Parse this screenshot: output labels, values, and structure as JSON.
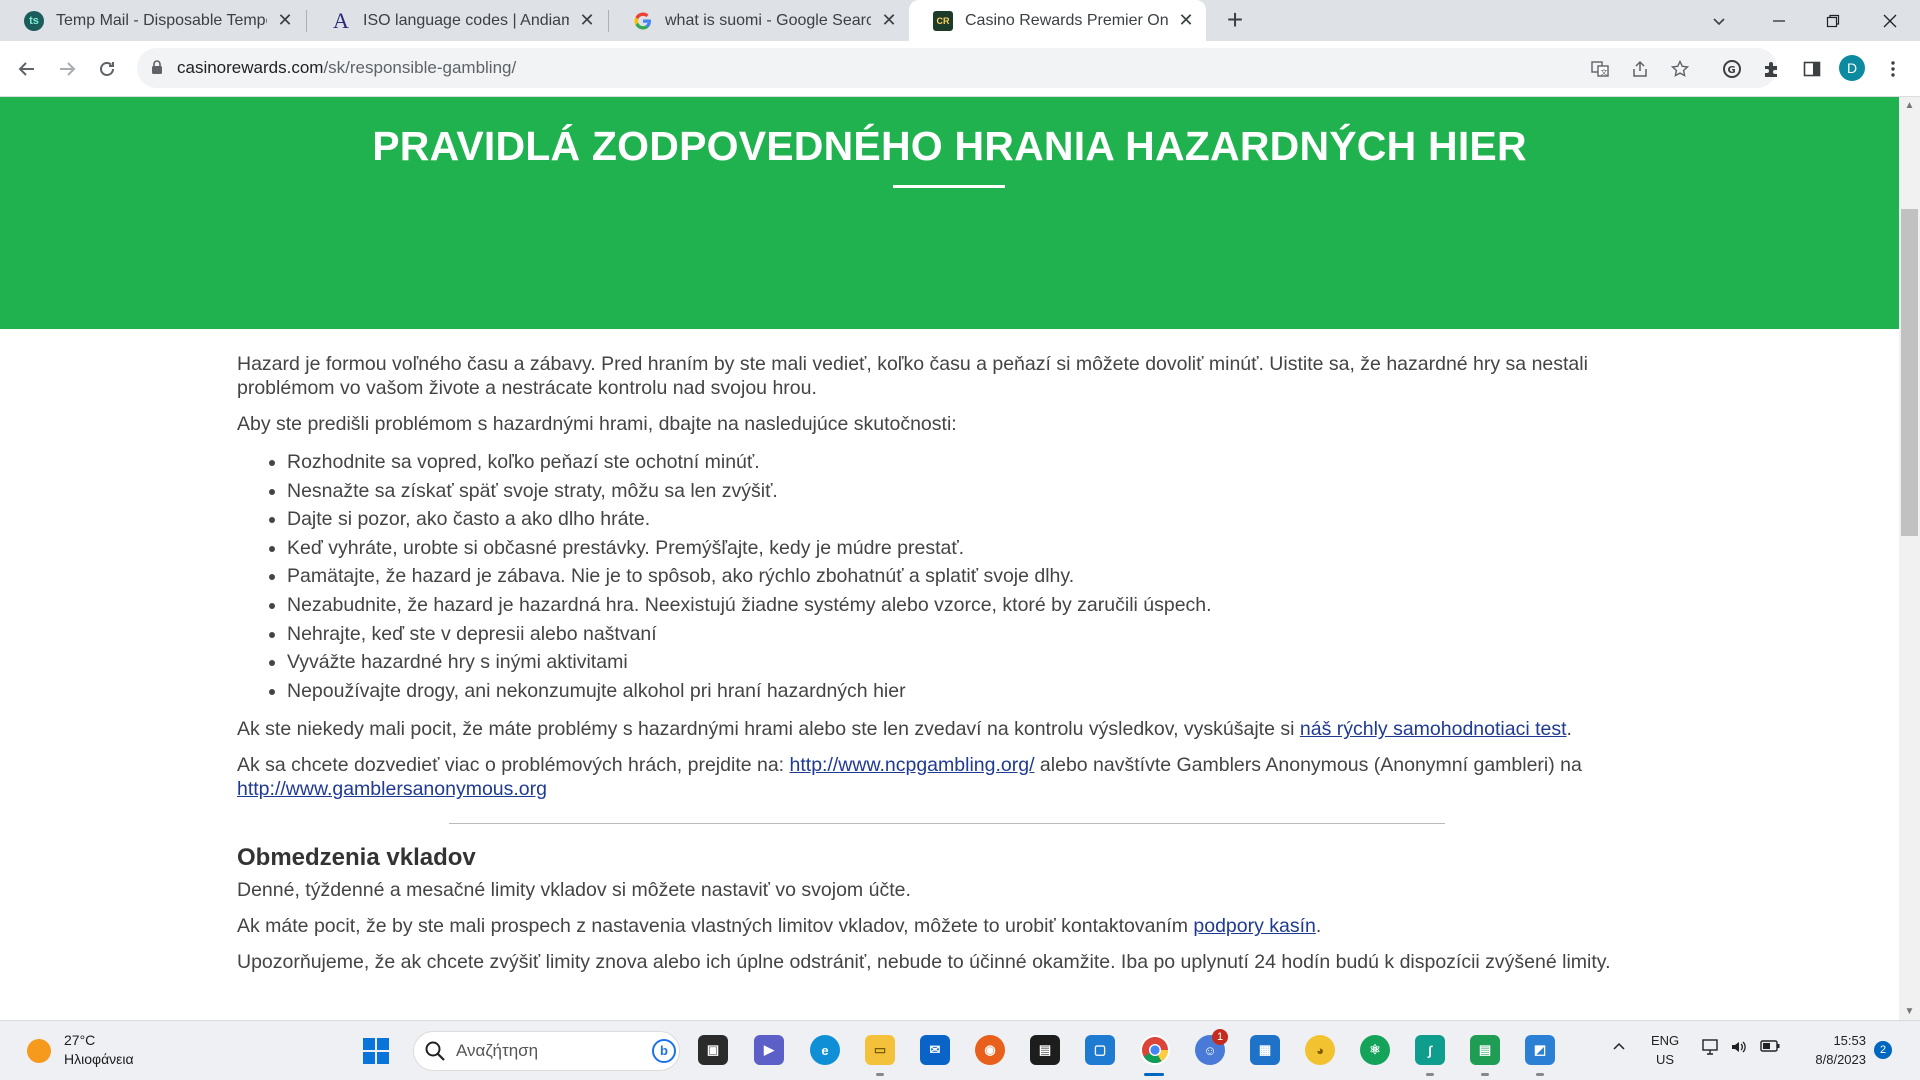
{
  "browser": {
    "tabs": [
      {
        "title": "Temp Mail - Disposable Temporary Email",
        "favicon": "tempmail-icon",
        "active": false
      },
      {
        "title": "ISO language codes | Andiamo! Translations",
        "favicon": "andiamo-icon",
        "active": false
      },
      {
        "title": "what is suomi - Google Search",
        "favicon": "google-icon",
        "active": false
      },
      {
        "title": "Casino Rewards Premier Online Casino",
        "favicon": "casino-rewards-icon",
        "active": true
      }
    ],
    "new_tab": "+",
    "url_host": "casinorewards.com",
    "url_path": "/sk/responsible-gambling/",
    "profile_initial": "D"
  },
  "page": {
    "title": "PRAVIDLÁ ZODPOVEDNÉHO HRANIA HAZARDNÝCH HIER",
    "intro": "Hazard je formou voľného času a zábavy. Pred hraním by ste mali vedieť, koľko času a peňazí si môžete dovoliť minúť. Uistite sa, že hazardné hry sa nestali problémom vo vašom živote a nestrácate kontrolu nad svojou hrou.",
    "lead": "Aby ste predišli problémom s hazardnými hrami, dbajte na nasledujúce skutočnosti:",
    "tips": [
      "Rozhodnite sa vopred, koľko peňazí ste ochotní minúť.",
      "Nesnažte sa získať späť svoje straty, môžu sa len zvýšiť.",
      "Dajte si pozor, ako často a ako dlho hráte.",
      "Keď vyhráte, urobte si občasné prestávky. Premýšľajte, kedy je múdre prestať.",
      "Pamätajte, že hazard je zábava. Nie je to spôsob, ako rýchlo zbohatnúť a splatiť svoje dlhy.",
      "Nezabudnite, že hazard je hazardná hra. Neexistujú žiadne systémy alebo vzorce, ktoré by zaručili úspech.",
      "Nehrajte, keď ste v depresii alebo naštvaní",
      "Vyvážte hazardné hry s inými aktivitami",
      "Nepoužívajte drogy, ani nekonzumujte alkohol pri hraní hazardných hier"
    ],
    "selftest_text": "Ak ste niekedy mali pocit, že máte problémy s hazardnými hrami alebo ste len zvedaví na kontrolu výsledkov, vyskúšajte si ",
    "selftest_link": "náš rýchly samohodnotiaci test",
    "selftest_end": ".",
    "more_text": "Ak sa chcete dozvedieť viac o problémových hrách, prejdite na: ",
    "ncpg_link": "http://www.ncpgambling.org/",
    "more_mid": " alebo navštívte Gamblers Anonymous (Anonymní gambleri) na ",
    "ga_link": "http://www.gamblersanonymous.org",
    "deposit_heading": "Obmedzenia vkladov",
    "deposit_p1": "Denné, týždenné a mesačné limity vkladov si môžete nastaviť vo svojom účte.",
    "deposit_p2_text": "Ak máte pocit, že by ste mali prospech z nastavenia vlastných limitov vkladov, môžete to urobiť kontaktovaním ",
    "deposit_p2_link": "podpory kasín",
    "deposit_p2_end": ".",
    "deposit_p3": "Upozorňujeme, že ak chcete zvýšiť limity znova alebo ich úplne odstrániť, nebude to účinné okamžite. Iba po uplynutí 24 hodín budú k dispozícii zvýšené limity."
  },
  "taskbar": {
    "temperature": "27°C",
    "weather": "Ηλιοφάνεια",
    "search_placeholder": "Αναζήτηση",
    "chat_badge": "1",
    "lang_top": "ENG",
    "lang_bottom": "US",
    "time": "15:53",
    "date": "8/8/2023",
    "notifications": "2"
  },
  "colors": {
    "hero_green": "#1fb24f",
    "link": "#1f3a93",
    "body_text": "#444444",
    "tab_strip": "#dee1e6"
  }
}
